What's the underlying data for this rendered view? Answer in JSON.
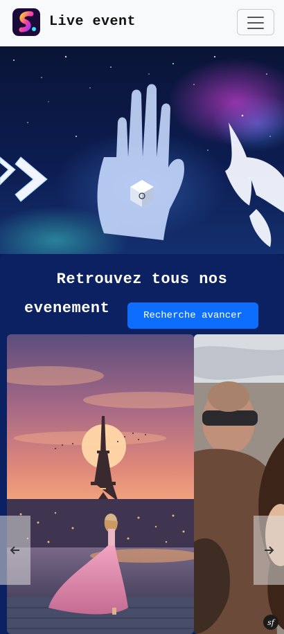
{
  "navbar": {
    "brand_name": "Live event",
    "logo_icon": "app-logo-icon",
    "menu_icon": "hamburger-menu-icon"
  },
  "hero": {
    "image": "hand-in-galaxy-illustration"
  },
  "events": {
    "heading_line1": "Retrouvez tous nos",
    "heading_line2": "evenement",
    "search_button_label": "Recherche avancer"
  },
  "carousel": {
    "slides": [
      {
        "image": "eiffel-tower-sunset-woman-pink-dress"
      },
      {
        "image": "festival-crowd-man-sunglasses"
      }
    ],
    "prev_icon": "arrow-left-icon",
    "next_icon": "arrow-right-icon"
  },
  "colors": {
    "navbar_bg": "#f8f9fa",
    "section_bg": "#0c2161",
    "button_primary": "#0d6efd"
  },
  "debug_badge": "sf"
}
